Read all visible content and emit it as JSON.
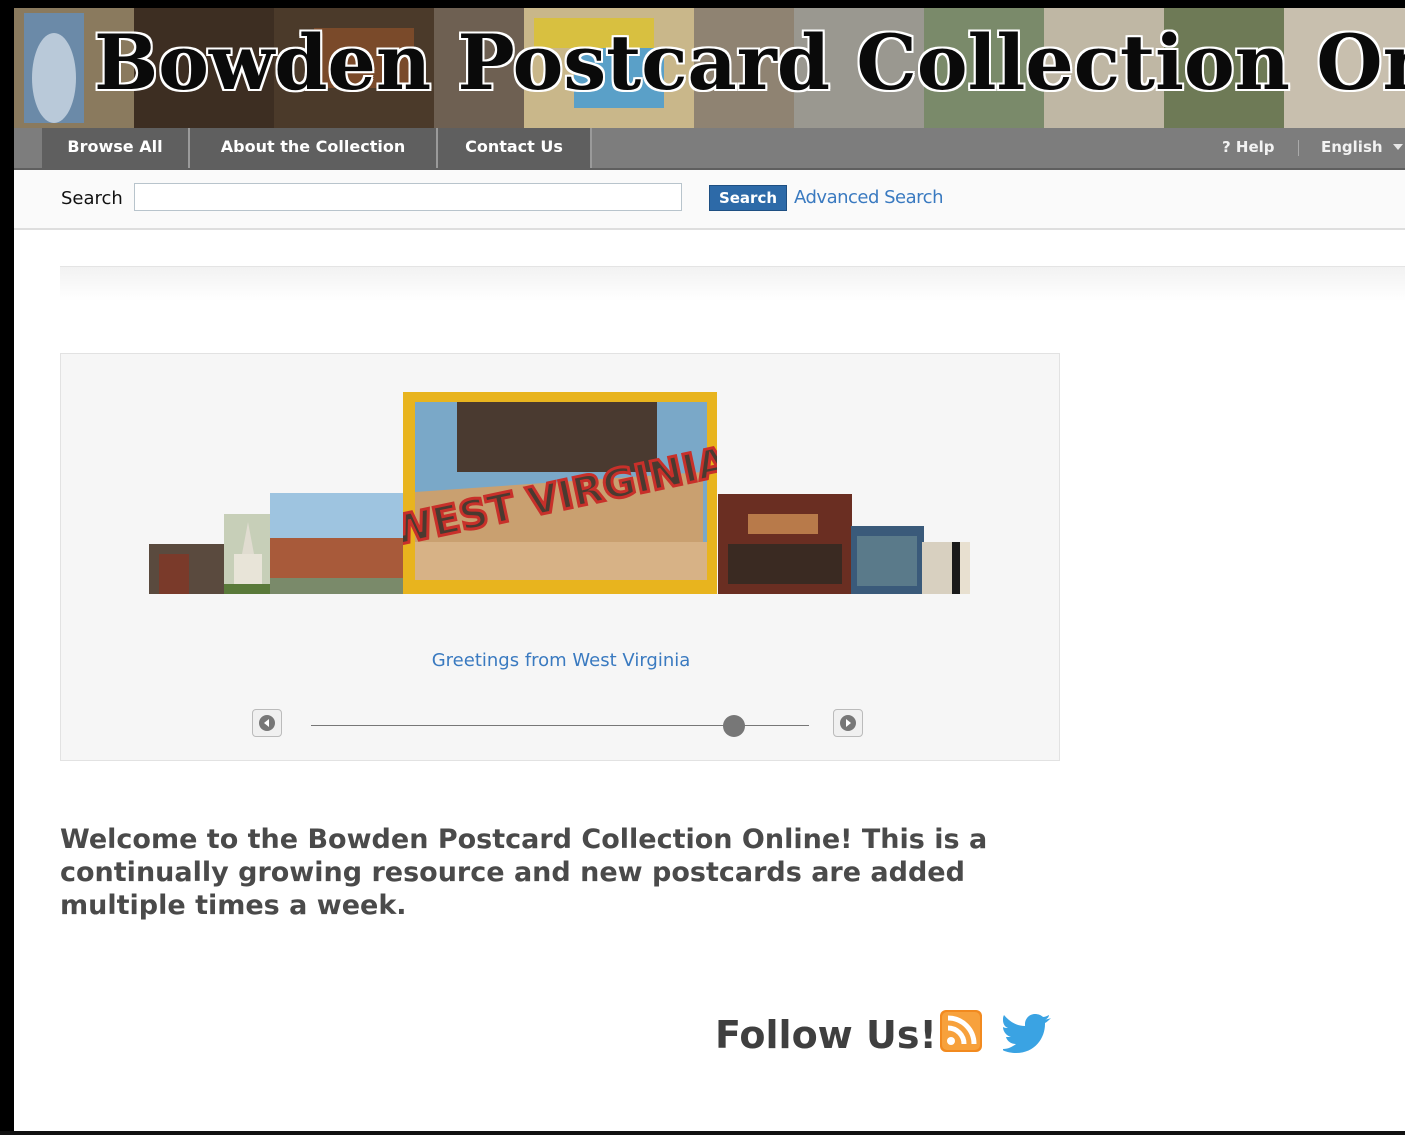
{
  "banner": {
    "title": "Bowden Postcard Collection Online"
  },
  "nav": {
    "items": [
      "Browse All",
      "About the Collection",
      "Contact Us"
    ],
    "help": "? Help",
    "language": "English"
  },
  "search": {
    "label": "Search",
    "placeholder": "",
    "button": "Search",
    "advanced": "Advanced Search"
  },
  "carousel": {
    "caption": "Greetings from West Virginia",
    "postcard_lettering": "Greetings from WEST VIRGINIA",
    "slider_position": 0.85
  },
  "welcome": "Welcome to the Bowden Postcard Collection Online! This is a continually growing resource and new postcards are added multiple times a week.",
  "follow": {
    "label": "Follow Us!"
  },
  "icons": {
    "rss": "rss-feed-icon",
    "twitter": "twitter-bird-icon",
    "prev": "previous-arrow-icon",
    "next": "next-arrow-icon",
    "language_dropdown": "caret-down-icon"
  },
  "colors": {
    "nav_bg": "#7d7d7d",
    "nav_item_bg": "#5f5f5f",
    "link": "#3a7ac0",
    "search_button": "#2d6aa8",
    "rss": "#f28a1f",
    "twitter": "#3aa3e3"
  }
}
